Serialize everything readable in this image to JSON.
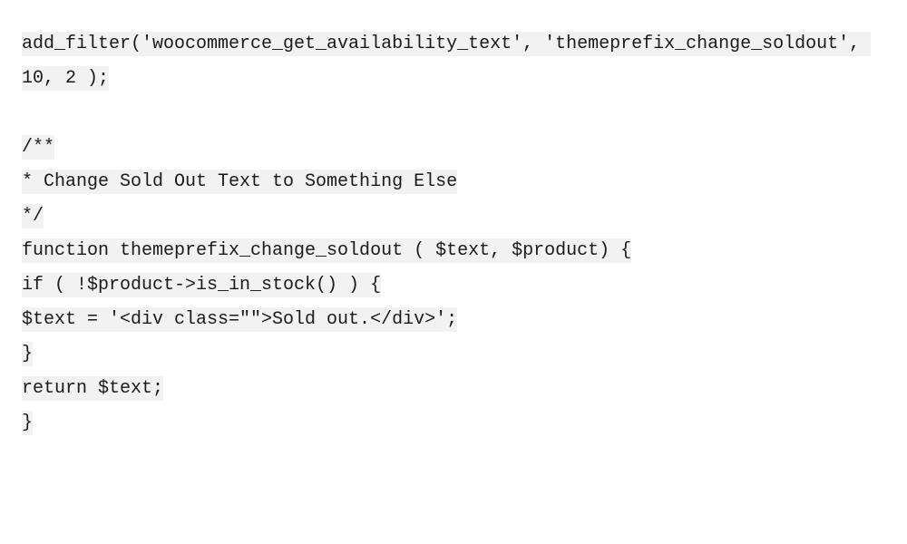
{
  "code": {
    "lines": [
      "add_filter('woocommerce_get_availability_text', 'themeprefix_change_soldout', 10, 2 );",
      "",
      "/**",
      "* Change Sold Out Text to Something Else",
      "*/",
      "function themeprefix_change_soldout ( $text, $product) {",
      "if ( !$product->is_in_stock() ) {",
      "$text = '<div class=\"\">Sold out.</div>';",
      "}",
      "return $text;",
      "}"
    ]
  }
}
